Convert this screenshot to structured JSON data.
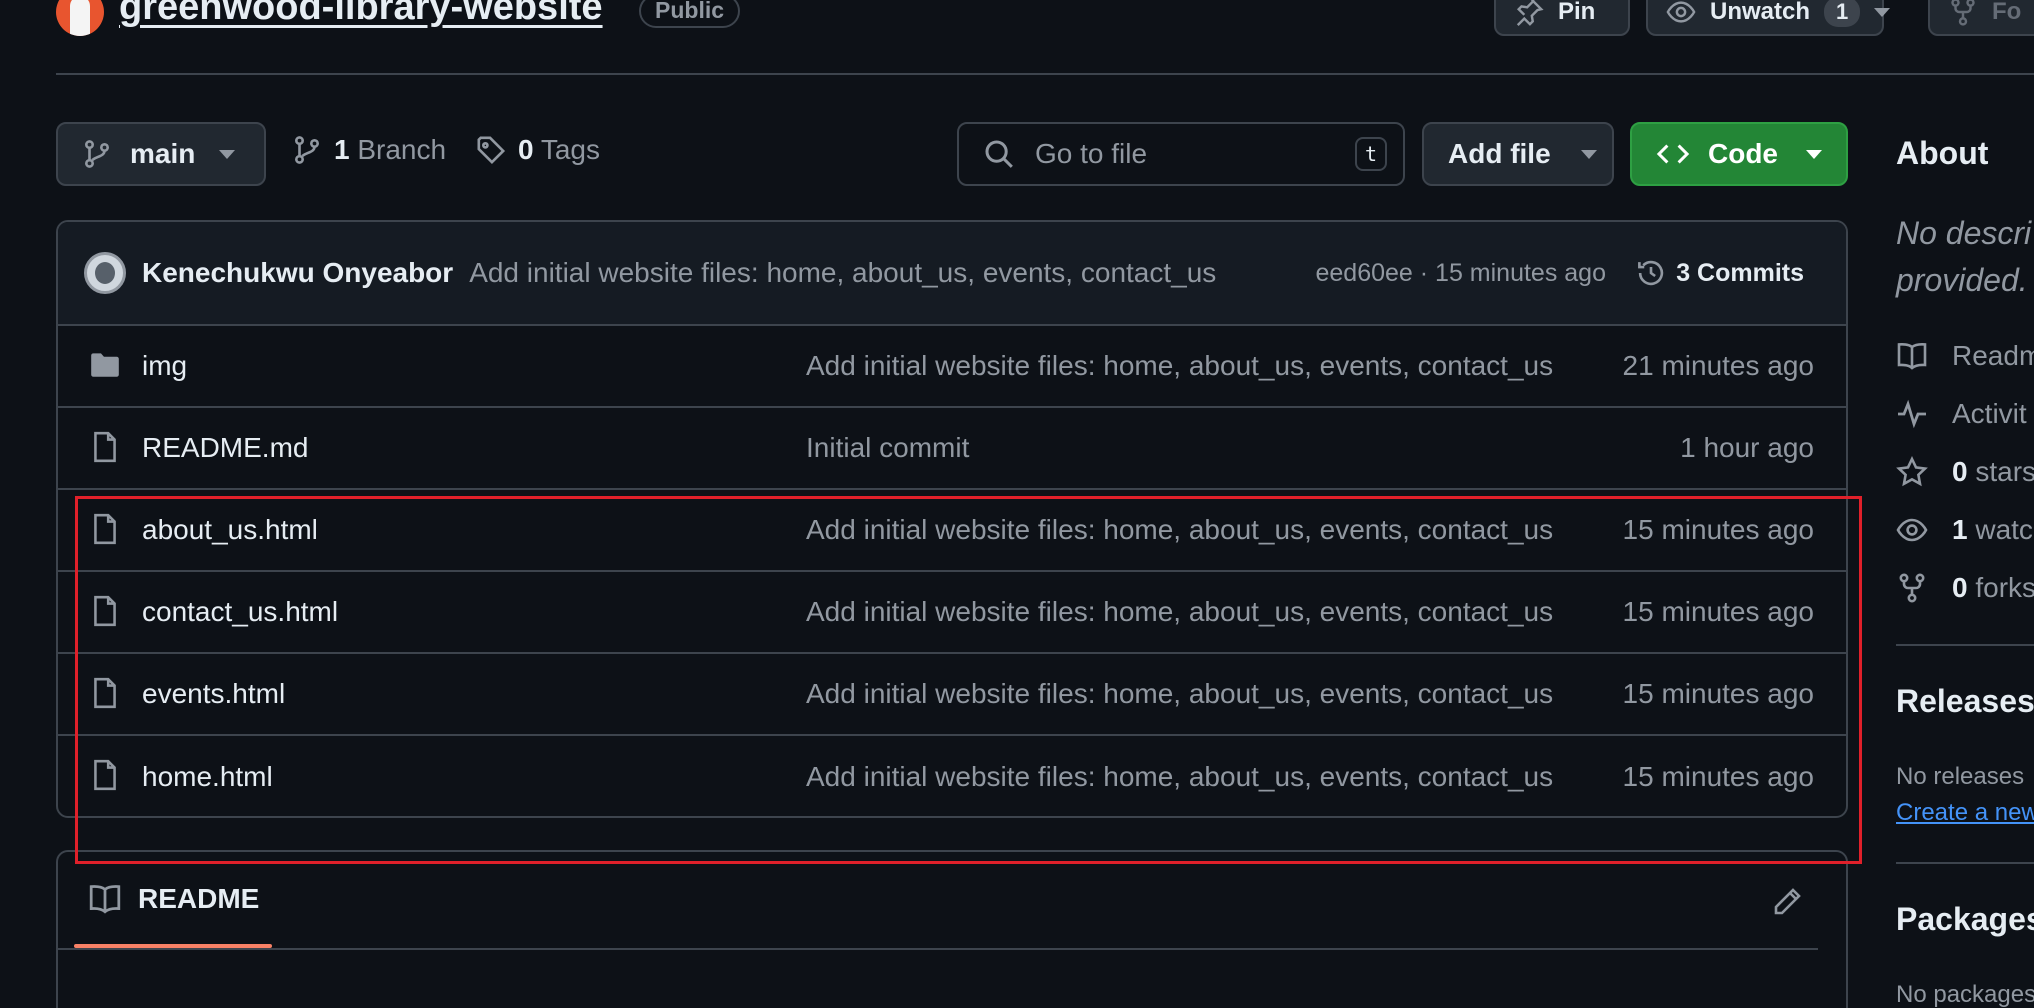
{
  "header": {
    "repo_name": "greenwood-library-website",
    "visibility": "Public",
    "pin_label": "Pin",
    "unwatch_label": "Unwatch",
    "watch_count": "1",
    "fork_label": "Fo"
  },
  "toolbar": {
    "branch": "main",
    "branches_count": "1",
    "branches_label": "Branch",
    "tags_count": "0",
    "tags_label": "Tags",
    "search_placeholder": "Go to file",
    "search_shortcut": "t",
    "add_file_label": "Add file",
    "code_label": "Code"
  },
  "latest_commit": {
    "author": "Kenechukwu Onyeabor",
    "message": "Add initial website files: home, about_us, events, contact_us",
    "hash_time": "eed60ee · 15 minutes ago",
    "commits_label": "3 Commits"
  },
  "files": [
    {
      "name": "img",
      "type": "folder",
      "message": "Add initial website files: home, about_us, events, contact_us",
      "time": "21 minutes ago"
    },
    {
      "name": "README.md",
      "type": "file",
      "message": "Initial commit",
      "time": "1 hour ago"
    },
    {
      "name": "about_us.html",
      "type": "file",
      "message": "Add initial website files: home, about_us, events, contact_us",
      "time": "15 minutes ago"
    },
    {
      "name": "contact_us.html",
      "type": "file",
      "message": "Add initial website files: home, about_us, events, contact_us",
      "time": "15 minutes ago"
    },
    {
      "name": "events.html",
      "type": "file",
      "message": "Add initial website files: home, about_us, events, contact_us",
      "time": "15 minutes ago"
    },
    {
      "name": "home.html",
      "type": "file",
      "message": "Add initial website files: home, about_us, events, contact_us",
      "time": "15 minutes ago"
    }
  ],
  "readme": {
    "tab_label": "README"
  },
  "sidebar": {
    "about_heading": "About",
    "description_line1": "No descri",
    "description_line2": "provided.",
    "readme_label": "Readm",
    "activity_label": "Activit",
    "stars_count": "0",
    "stars_label": "stars",
    "watch_count": "1",
    "watch_label": "watc",
    "forks_count": "0",
    "forks_label": "forks",
    "releases_heading": "Releases",
    "no_releases": "No releases",
    "create_release": "Create a new",
    "packages_heading": "Packages",
    "no_packages": "No packages"
  },
  "colors": {
    "background": "#0d1117",
    "border": "#3d444d",
    "code_button": "#238636",
    "highlight_box": "#e0202a",
    "readme_tab_underline": "#f78166",
    "link": "#4493f8"
  },
  "icons": [
    "branch-icon",
    "tag-icon",
    "search-icon",
    "code-icon",
    "history-icon",
    "folder-icon",
    "file-icon",
    "book-icon",
    "pencil-icon",
    "pin-icon",
    "eye-icon",
    "fork-icon",
    "pulse-icon",
    "star-icon"
  ]
}
